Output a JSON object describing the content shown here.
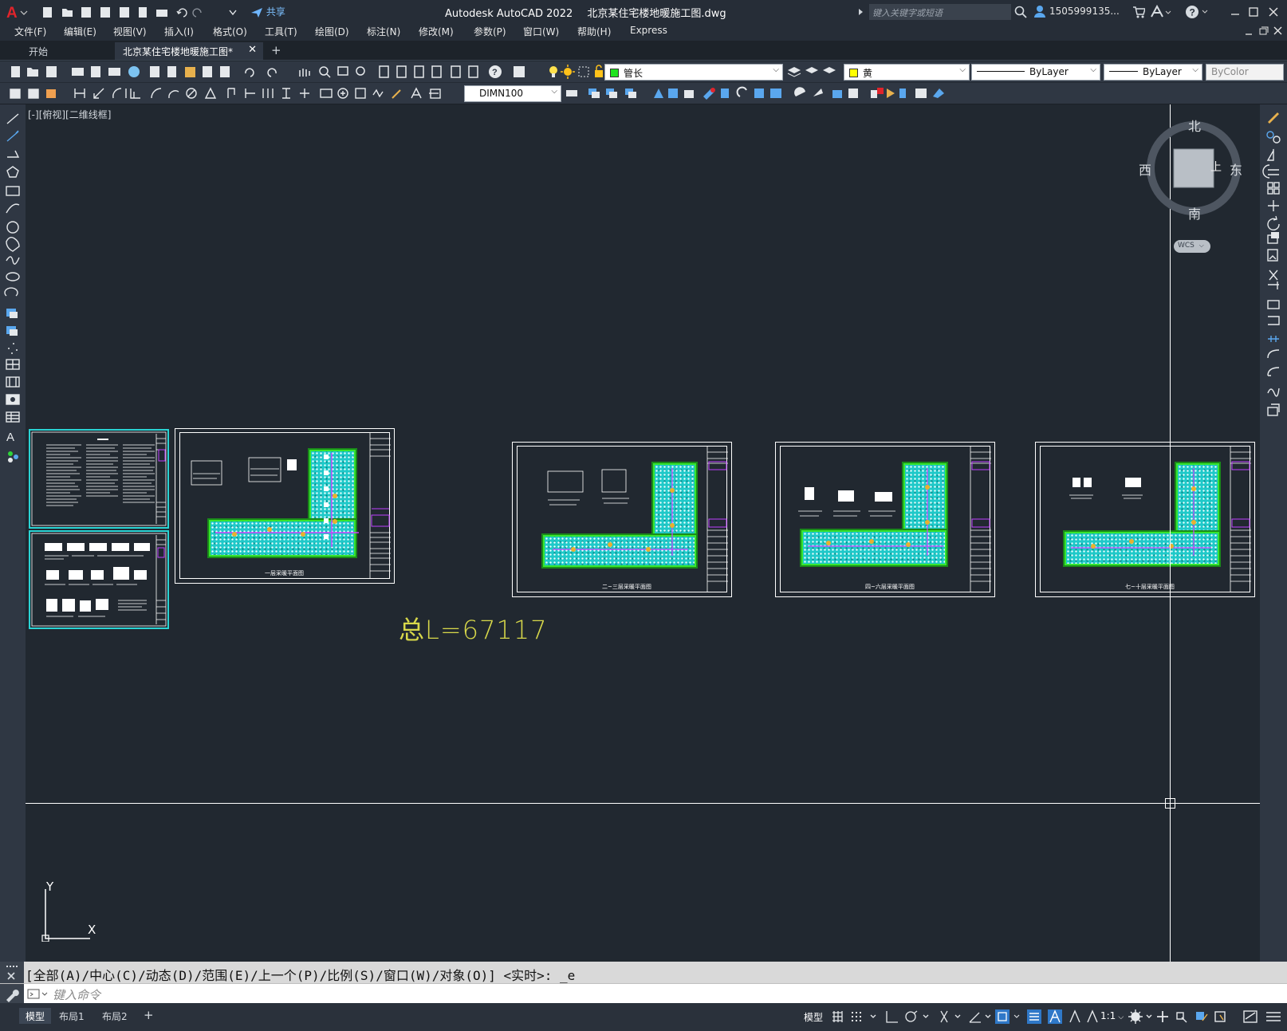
{
  "app": {
    "title": "Autodesk AutoCAD 2022",
    "file": "北京某住宅楼地暖施工图.dwg",
    "search_placeholder": "键入关键字或短语",
    "user": "1505999135...",
    "share": "共享"
  },
  "menu": [
    "文件(F)",
    "编辑(E)",
    "视图(V)",
    "插入(I)",
    "格式(O)",
    "工具(T)",
    "绘图(D)",
    "标注(N)",
    "修改(M)",
    "参数(P)",
    "窗口(W)",
    "帮助(H)",
    "Express"
  ],
  "tabs": {
    "start": "开始",
    "active": "北京某住宅楼地暖施工图*",
    "add": "+"
  },
  "toolbar": {
    "layer_name": "管长",
    "layer_color": "#1ee31e",
    "color_name": "黄",
    "color_swatch": "#ffff00",
    "linetype": "ByLayer",
    "lineweight": "ByLayer",
    "plotstyle": "ByColor",
    "dimstyle": "DIMN100"
  },
  "viewport": {
    "label": "[-][俯视][二维线框]",
    "total_length": "总L=67117",
    "viewcube": {
      "north": "北",
      "south": "南",
      "west": "西",
      "east": "东",
      "top": "上",
      "wcs": "WCS"
    },
    "ucs": {
      "x": "X",
      "y": "Y"
    }
  },
  "sheets": {
    "s2_caption": "一层采暖平面图",
    "s3_caption": "二~三层采暖平面图",
    "s4_caption": "四~六层采暖平面图",
    "s5_caption": "七~十层采暖平面图"
  },
  "command": {
    "history": "[全部(A)/中心(C)/动态(D)/范围(E)/上一个(P)/比例(S)/窗口(W)/对象(O)] <实时>: _e",
    "placeholder": "键入命令"
  },
  "layouts": [
    "模型",
    "布局1",
    "布局2"
  ],
  "status": {
    "model": "模型",
    "scale": "1:1"
  },
  "colors": {
    "background": "#212830",
    "toolbar": "#2f3743",
    "hatch": "#1fc9c9",
    "wall": "#35e62e",
    "annotation": "#d8d84a"
  }
}
